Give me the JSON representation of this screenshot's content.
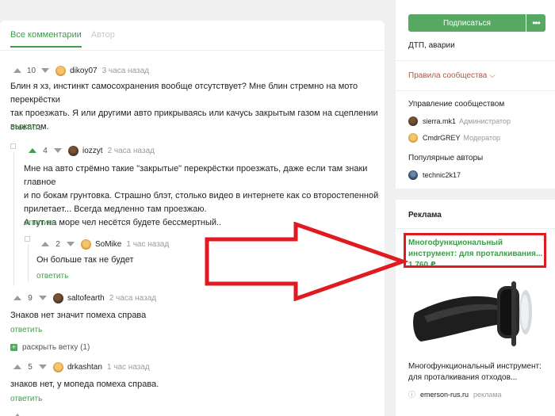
{
  "tabs": {
    "all_comments": "Все комментарии",
    "author": "Автор"
  },
  "comments": [
    {
      "rating": "10",
      "author": "dikoy07",
      "time": "3 часа назад",
      "text": [
        "Блин я хз, инстинкт самосохранения вообще отсутствует? Мне блин стремно на мото перекрёстки",
        "так проезжать. Я или другими авто прикрываясь или качусь закрытым газом на сцеплении",
        "выжатом."
      ],
      "reply": "ответить"
    },
    {
      "rating": "4",
      "author": "iozzyt",
      "time": "2 часа назад",
      "text": [
        "Мне на авто стрёмно такие \"закрытые\" перекрёстки проезжать, даже если там знаки главное",
        "и по бокам грунтовка. Страшно блэт, столько видео в интернете как со второстепенной",
        "прилетает... Всегда медленно там проезжаю.",
        "А тут на море чел несётся будете бессмертный.."
      ],
      "reply": "ответить"
    },
    {
      "rating": "2",
      "author": "SoMike",
      "time": "1 час назад",
      "text": [
        "Он больше так не будет"
      ],
      "reply": "ответить"
    },
    {
      "rating": "9",
      "author": "saltofearth",
      "time": "2 часа назад",
      "text": [
        "Знаков нет значит помеха справа"
      ],
      "reply": "ответить"
    },
    {
      "rating": "5",
      "author": "drkashtan",
      "time": "1 час назад",
      "text": [
        "знаков нет, у мопеда помеха справа."
      ],
      "reply": "ответить"
    }
  ],
  "expand_branch": "раскрыть ветку (1)",
  "sidebar": {
    "subscribe": "Подписаться",
    "more": "•••",
    "tags": "ДТП, аварии",
    "rules": "Правила сообщества",
    "management_title": "Управление сообществом",
    "admins": [
      {
        "name": "sierra.mk1",
        "role": "Администратор"
      },
      {
        "name": "CmdrGREY",
        "role": "Модератор"
      }
    ],
    "popular_title": "Популярные авторы",
    "popular": [
      {
        "name": "technic2k17"
      }
    ]
  },
  "ad": {
    "header": "Реклама",
    "title": "Многофункциональный инструмент: для проталкивания... 1 760 ₽",
    "description": "Многофункциональный инструмент: для проталкивания отходов...",
    "source": "emerson-rus.ru",
    "label": "реклама"
  },
  "colors": {
    "accent": "#56a862",
    "link_green": "#3e9c4c",
    "highlight_red": "#e11a22"
  }
}
